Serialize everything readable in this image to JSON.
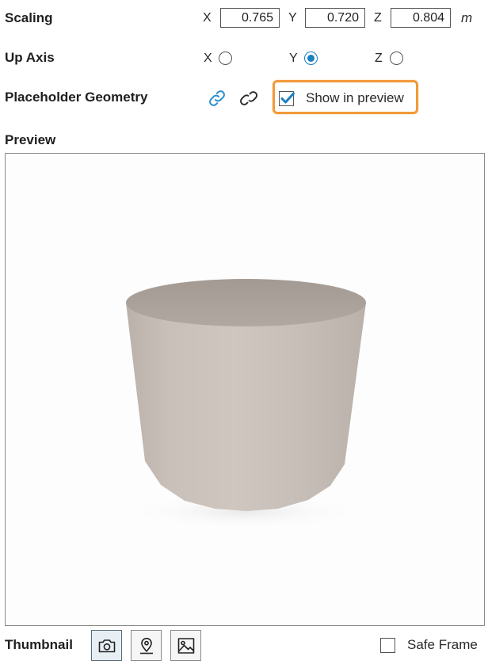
{
  "scaling": {
    "label": "Scaling",
    "x_letter": "X",
    "x_value": "0.765",
    "y_letter": "Y",
    "y_value": "0.720",
    "z_letter": "Z",
    "z_value": "0.804",
    "unit": "m"
  },
  "up_axis": {
    "label": "Up Axis",
    "options": [
      {
        "letter": "X",
        "selected": false
      },
      {
        "letter": "Y",
        "selected": true
      },
      {
        "letter": "Z",
        "selected": false
      }
    ]
  },
  "placeholder_geometry": {
    "label": "Placeholder Geometry",
    "link_icon": "link-icon",
    "unlink_icon": "unlink-icon",
    "show_in_preview_label": "Show in preview",
    "show_in_preview_checked": true,
    "highlight_color": "#f29a3a"
  },
  "preview": {
    "label": "Preview",
    "model_shape": "cylinder",
    "model_color": "#c7bfb8"
  },
  "thumbnail": {
    "label": "Thumbnail",
    "buttons": [
      {
        "icon": "camera-icon",
        "active": true
      },
      {
        "icon": "map-pin-icon",
        "active": false
      },
      {
        "icon": "image-icon",
        "active": false
      }
    ],
    "safe_frame_label": "Safe Frame",
    "safe_frame_checked": false
  },
  "colors": {
    "accent": "#1a7fc1",
    "text": "#1f1f1f"
  }
}
